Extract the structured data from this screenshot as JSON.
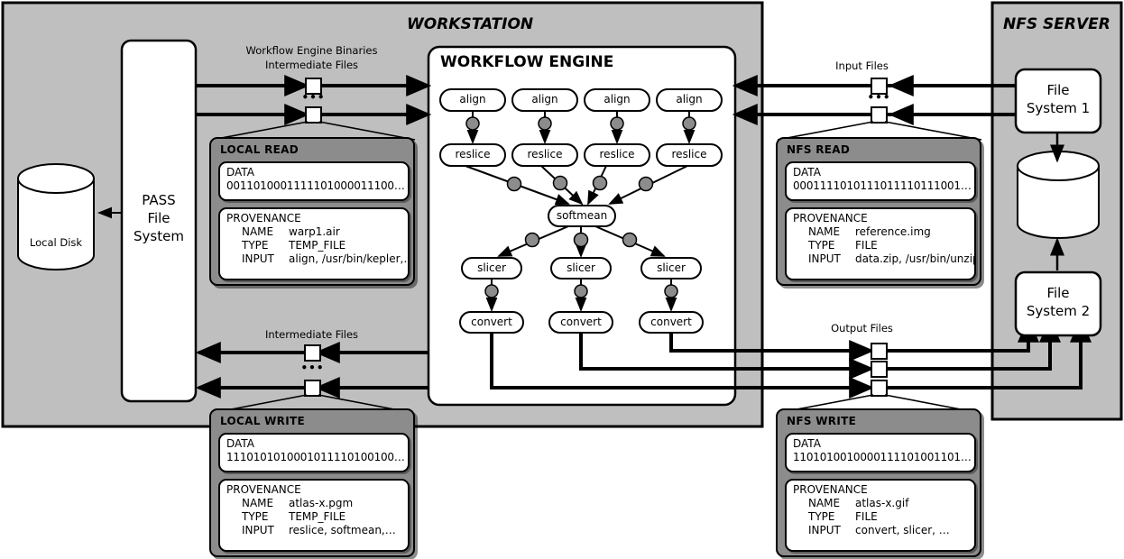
{
  "zones": {
    "workstation": {
      "title": "WORKSTATION"
    },
    "nfs_server": {
      "title": "NFS SERVER"
    }
  },
  "workflow_engine": {
    "title": "WORKFLOW ENGINE",
    "stages": {
      "align": [
        "align",
        "align",
        "align",
        "align"
      ],
      "reslice": [
        "reslice",
        "reslice",
        "reslice",
        "reslice"
      ],
      "softmean": "softmean",
      "slicer": [
        "slicer",
        "slicer",
        "slicer"
      ],
      "convert": [
        "convert",
        "convert",
        "convert"
      ]
    }
  },
  "storage": {
    "pass_file_system": "PASS\nFile\nSystem",
    "pass_file_system_lines": [
      "PASS",
      "File",
      "System"
    ],
    "local_disk": "Local Disk",
    "file_system_1_lines": [
      "File",
      "System 1"
    ],
    "file_system_2_lines": [
      "File",
      "System 2"
    ]
  },
  "channel_labels": {
    "left_top_line1": "Workflow Engine Binaries",
    "left_top_line2": "Intermediate Files",
    "left_bottom": "Intermediate Files",
    "right_top": "Input Files",
    "right_bottom": "Output Files",
    "ellipsis": "•••"
  },
  "cards": {
    "local_read": {
      "title": "LOCAL READ",
      "data_label": "DATA",
      "data_value": "0011010001111101000011100…",
      "prov_label": "PROVENANCE",
      "fields": [
        {
          "key": "NAME",
          "value": "warp1.air"
        },
        {
          "key": "TYPE",
          "value": "TEMP_FILE"
        },
        {
          "key": "INPUT",
          "value": "align, /usr/bin/kepler,…"
        }
      ]
    },
    "nfs_read": {
      "title": "NFS READ",
      "data_label": "DATA",
      "data_value": "0001111010111011110111001…",
      "prov_label": "PROVENANCE",
      "fields": [
        {
          "key": "NAME",
          "value": "reference.img"
        },
        {
          "key": "TYPE",
          "value": "FILE"
        },
        {
          "key": "INPUT",
          "value": "data.zip, /usr/bin/unzip"
        }
      ]
    },
    "local_write": {
      "title": "LOCAL WRITE",
      "data_label": "DATA",
      "data_value": "1110101010001011110100100…",
      "prov_label": "PROVENANCE",
      "fields": [
        {
          "key": "NAME",
          "value": "atlas-x.pgm"
        },
        {
          "key": "TYPE",
          "value": "TEMP_FILE"
        },
        {
          "key": "INPUT",
          "value": "reslice, softmean,…"
        }
      ]
    },
    "nfs_write": {
      "title": "NFS WRITE",
      "data_label": "DATA",
      "data_value": "1101010010000111101001101…",
      "prov_label": "PROVENANCE",
      "fields": [
        {
          "key": "NAME",
          "value": "atlas-x.gif"
        },
        {
          "key": "TYPE",
          "value": "FILE"
        },
        {
          "key": "INPUT",
          "value": "convert, slicer, …"
        }
      ]
    }
  },
  "colors": {
    "zone_fill": "#bfbfbf",
    "card_fill": "#8c8c8c",
    "panel_fill": "#ffffff",
    "node_fill": "#ffffff",
    "prov_dot": "#8c8c8c",
    "stroke": "#000000"
  }
}
